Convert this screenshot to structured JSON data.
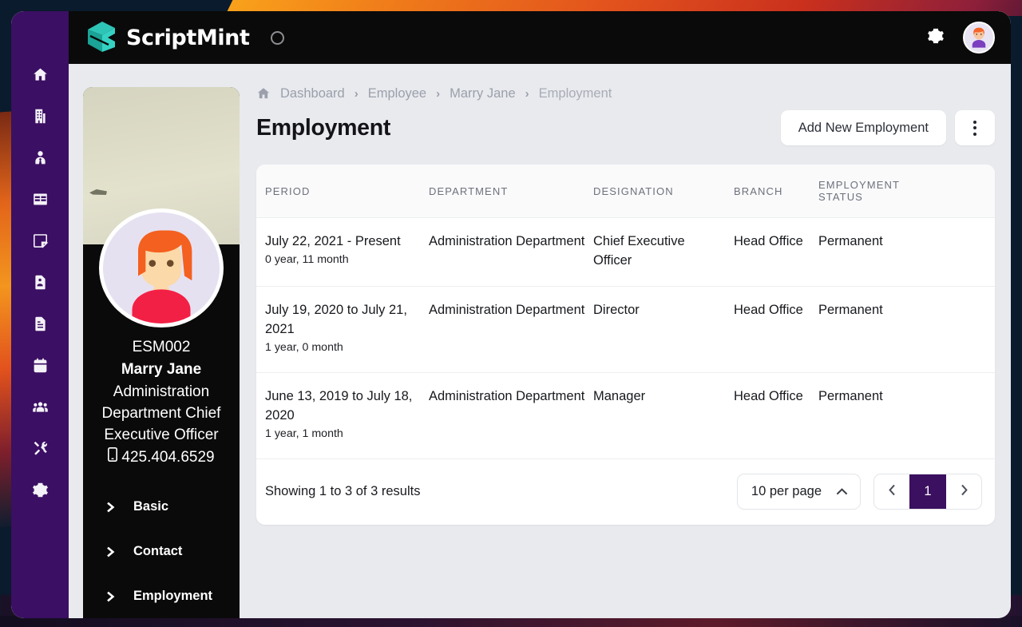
{
  "app": {
    "brand": "ScriptMint",
    "logo_icon": "scriptmint-logo",
    "loading_icon": "spinner-circle",
    "settings_icon": "gear-icon",
    "avatar_icon": "user-avatar"
  },
  "rail": {
    "items": [
      {
        "name": "dashboard",
        "icon": "home-icon"
      },
      {
        "name": "company",
        "icon": "building-icon"
      },
      {
        "name": "employee",
        "icon": "user-tie-icon"
      },
      {
        "name": "grid",
        "icon": "table-icon"
      },
      {
        "name": "notes",
        "icon": "sticky-note-icon"
      },
      {
        "name": "resume",
        "icon": "file-user-icon"
      },
      {
        "name": "documents",
        "icon": "file-lines-icon"
      },
      {
        "name": "calendar",
        "icon": "calendar-icon"
      },
      {
        "name": "teams",
        "icon": "users-icon"
      },
      {
        "name": "tools",
        "icon": "tools-icon"
      },
      {
        "name": "settings",
        "icon": "gear-icon"
      }
    ]
  },
  "profile": {
    "code": "ESM002",
    "name": "Marry Jane",
    "role_line1": "Administration",
    "role_line2": "Department Chief",
    "role_line3": "Executive Officer",
    "phone": "425.404.6529",
    "phone_icon": "mobile-icon",
    "sections": [
      {
        "label": "Basic",
        "icon": "chevron-right-icon"
      },
      {
        "label": "Contact",
        "icon": "chevron-right-icon"
      },
      {
        "label": "Employment",
        "icon": "chevron-right-icon"
      }
    ]
  },
  "breadcrumb": {
    "home_icon": "home-icon",
    "separator": "›",
    "items": [
      {
        "label": "Dashboard"
      },
      {
        "label": "Employee"
      },
      {
        "label": "Marry Jane"
      },
      {
        "label": "Employment"
      }
    ]
  },
  "header": {
    "title": "Employment",
    "add_label": "Add New Employment",
    "more_icon": "kebab-menu-icon"
  },
  "table": {
    "columns": [
      "PERIOD",
      "DEPARTMENT",
      "DESIGNATION",
      "BRANCH",
      "EMPLOYMENT STATUS",
      ""
    ],
    "column_status_line1": "EMPLOYMENT",
    "column_status_line2": "STATUS",
    "rows": [
      {
        "period": "July 22, 2021 - Present",
        "duration": "0 year, 11 month",
        "department": "Administration Department",
        "designation": "Chief Executive Officer",
        "branch": "Head Office",
        "status": "Permanent",
        "row_menu_icon": "kebab-menu-icon"
      },
      {
        "period": "July 19, 2020 to July 21, 2021",
        "duration": "1 year, 0 month",
        "department": "Administration Department",
        "designation": "Director",
        "branch": "Head Office",
        "status": "Permanent",
        "row_menu_icon": "kebab-menu-icon"
      },
      {
        "period": "June 13, 2019 to July 18, 2020",
        "duration": "1 year, 1 month",
        "department": "Administration Department",
        "designation": "Manager",
        "branch": "Head Office",
        "status": "Permanent",
        "row_menu_icon": "kebab-menu-icon"
      }
    ]
  },
  "footer": {
    "showing": "Showing 1 to 3 of 3 results",
    "per_page": "10 per page",
    "per_page_icon": "chevron-up-icon",
    "prev_icon": "chevron-left-icon",
    "next_icon": "chevron-right-icon",
    "current_page": "1"
  },
  "colors": {
    "rail_purple": "#3B0F63",
    "active_page": "#3B1060",
    "topbar_black": "#0A0A0A",
    "canvas": "#E9EAEE",
    "brand_teal": "#1FB8A6",
    "backdrop_navy": "#0A1B2D",
    "accent_orange": "#F3951E"
  }
}
